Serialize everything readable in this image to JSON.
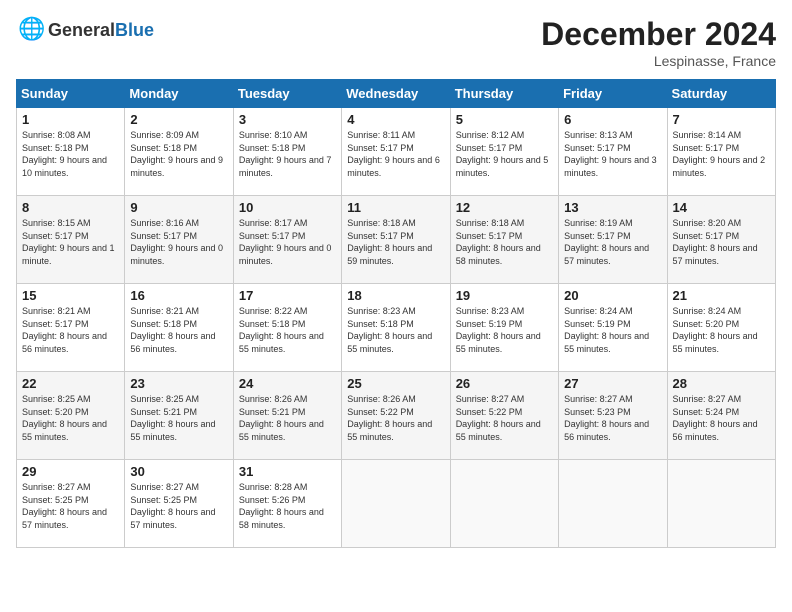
{
  "header": {
    "logo_general": "General",
    "logo_blue": "Blue",
    "title": "December 2024",
    "location": "Lespinasse, France"
  },
  "days_of_week": [
    "Sunday",
    "Monday",
    "Tuesday",
    "Wednesday",
    "Thursday",
    "Friday",
    "Saturday"
  ],
  "weeks": [
    [
      {
        "day": "1",
        "sunrise": "8:08 AM",
        "sunset": "5:18 PM",
        "daylight": "9 hours and 10 minutes."
      },
      {
        "day": "2",
        "sunrise": "8:09 AM",
        "sunset": "5:18 PM",
        "daylight": "9 hours and 9 minutes."
      },
      {
        "day": "3",
        "sunrise": "8:10 AM",
        "sunset": "5:18 PM",
        "daylight": "9 hours and 7 minutes."
      },
      {
        "day": "4",
        "sunrise": "8:11 AM",
        "sunset": "5:17 PM",
        "daylight": "9 hours and 6 minutes."
      },
      {
        "day": "5",
        "sunrise": "8:12 AM",
        "sunset": "5:17 PM",
        "daylight": "9 hours and 5 minutes."
      },
      {
        "day": "6",
        "sunrise": "8:13 AM",
        "sunset": "5:17 PM",
        "daylight": "9 hours and 3 minutes."
      },
      {
        "day": "7",
        "sunrise": "8:14 AM",
        "sunset": "5:17 PM",
        "daylight": "9 hours and 2 minutes."
      }
    ],
    [
      {
        "day": "8",
        "sunrise": "8:15 AM",
        "sunset": "5:17 PM",
        "daylight": "9 hours and 1 minute."
      },
      {
        "day": "9",
        "sunrise": "8:16 AM",
        "sunset": "5:17 PM",
        "daylight": "9 hours and 0 minutes."
      },
      {
        "day": "10",
        "sunrise": "8:17 AM",
        "sunset": "5:17 PM",
        "daylight": "9 hours and 0 minutes."
      },
      {
        "day": "11",
        "sunrise": "8:18 AM",
        "sunset": "5:17 PM",
        "daylight": "8 hours and 59 minutes."
      },
      {
        "day": "12",
        "sunrise": "8:18 AM",
        "sunset": "5:17 PM",
        "daylight": "8 hours and 58 minutes."
      },
      {
        "day": "13",
        "sunrise": "8:19 AM",
        "sunset": "5:17 PM",
        "daylight": "8 hours and 57 minutes."
      },
      {
        "day": "14",
        "sunrise": "8:20 AM",
        "sunset": "5:17 PM",
        "daylight": "8 hours and 57 minutes."
      }
    ],
    [
      {
        "day": "15",
        "sunrise": "8:21 AM",
        "sunset": "5:17 PM",
        "daylight": "8 hours and 56 minutes."
      },
      {
        "day": "16",
        "sunrise": "8:21 AM",
        "sunset": "5:18 PM",
        "daylight": "8 hours and 56 minutes."
      },
      {
        "day": "17",
        "sunrise": "8:22 AM",
        "sunset": "5:18 PM",
        "daylight": "8 hours and 55 minutes."
      },
      {
        "day": "18",
        "sunrise": "8:23 AM",
        "sunset": "5:18 PM",
        "daylight": "8 hours and 55 minutes."
      },
      {
        "day": "19",
        "sunrise": "8:23 AM",
        "sunset": "5:19 PM",
        "daylight": "8 hours and 55 minutes."
      },
      {
        "day": "20",
        "sunrise": "8:24 AM",
        "sunset": "5:19 PM",
        "daylight": "8 hours and 55 minutes."
      },
      {
        "day": "21",
        "sunrise": "8:24 AM",
        "sunset": "5:20 PM",
        "daylight": "8 hours and 55 minutes."
      }
    ],
    [
      {
        "day": "22",
        "sunrise": "8:25 AM",
        "sunset": "5:20 PM",
        "daylight": "8 hours and 55 minutes."
      },
      {
        "day": "23",
        "sunrise": "8:25 AM",
        "sunset": "5:21 PM",
        "daylight": "8 hours and 55 minutes."
      },
      {
        "day": "24",
        "sunrise": "8:26 AM",
        "sunset": "5:21 PM",
        "daylight": "8 hours and 55 minutes."
      },
      {
        "day": "25",
        "sunrise": "8:26 AM",
        "sunset": "5:22 PM",
        "daylight": "8 hours and 55 minutes."
      },
      {
        "day": "26",
        "sunrise": "8:27 AM",
        "sunset": "5:22 PM",
        "daylight": "8 hours and 55 minutes."
      },
      {
        "day": "27",
        "sunrise": "8:27 AM",
        "sunset": "5:23 PM",
        "daylight": "8 hours and 56 minutes."
      },
      {
        "day": "28",
        "sunrise": "8:27 AM",
        "sunset": "5:24 PM",
        "daylight": "8 hours and 56 minutes."
      }
    ],
    [
      {
        "day": "29",
        "sunrise": "8:27 AM",
        "sunset": "5:25 PM",
        "daylight": "8 hours and 57 minutes."
      },
      {
        "day": "30",
        "sunrise": "8:27 AM",
        "sunset": "5:25 PM",
        "daylight": "8 hours and 57 minutes."
      },
      {
        "day": "31",
        "sunrise": "8:28 AM",
        "sunset": "5:26 PM",
        "daylight": "8 hours and 58 minutes."
      },
      null,
      null,
      null,
      null
    ]
  ]
}
